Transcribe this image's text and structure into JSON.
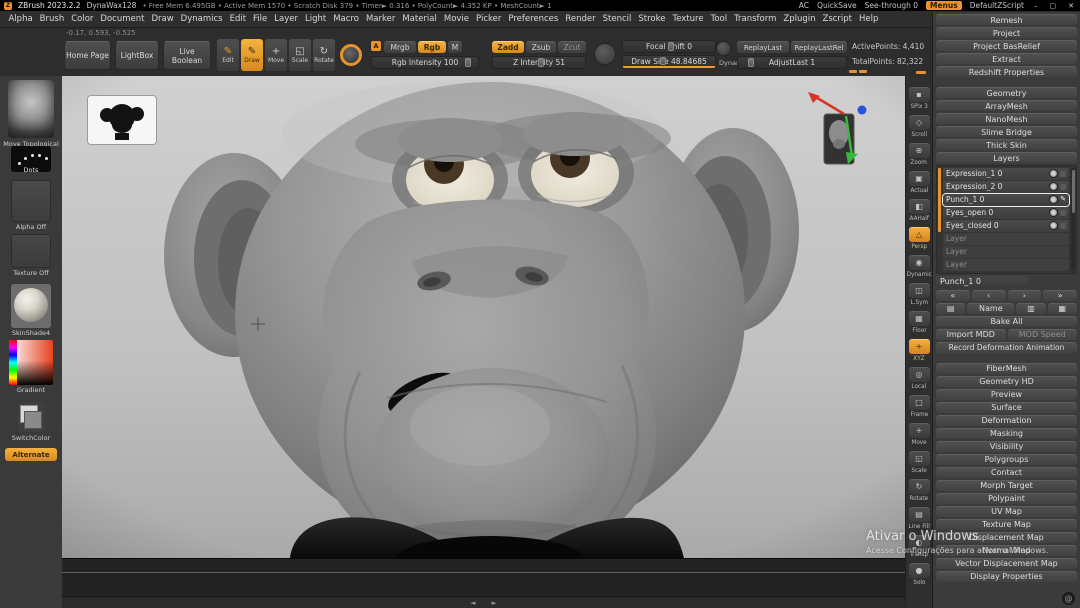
{
  "titlebar": {
    "logo_letter": "Z",
    "app_title": "ZBrush 2023.2.2",
    "doc_title": "DynaWax128",
    "stats": "• Free Mem 6.495GB • Active Mem 1570 • Scratch Disk 379 • Timer► 0.316 • PolyCount► 4.352 KP • MeshCount► 1",
    "right_items": [
      "AC",
      "QuickSave",
      "See-through 0"
    ],
    "menus_button": "Menus",
    "zscript_button": "DefaultZScript",
    "win_min": "–",
    "win_max": "▢",
    "win_close": "✕"
  },
  "menubar": {
    "items": [
      "Alpha",
      "Brush",
      "Color",
      "Document",
      "Draw",
      "Dynamics",
      "Edit",
      "File",
      "Layer",
      "Light",
      "Macro",
      "Marker",
      "Material",
      "Movie",
      "Picker",
      "Preferences",
      "Render",
      "Stencil",
      "Stroke",
      "Texture",
      "Tool",
      "Transform",
      "Zplugin",
      "Zscript",
      "Help"
    ]
  },
  "shelf": {
    "coords": "-0.17, 0.593, -0.525",
    "home_page": "Home Page",
    "lightbox": "LightBox",
    "live_boolean": "Live Boolean",
    "mode_edit": "Edit",
    "mode_draw": "Draw",
    "mode_move": "Move",
    "mode_scale": "Scale",
    "mode_rotate": "Rotate",
    "mode_icons": {
      "edit": "✎",
      "draw": "✎",
      "move": "+",
      "scale": "◱",
      "rotate": "↻"
    },
    "channel_a": "A",
    "mrgb": "Mrgb",
    "rgb": "Rgb",
    "m": "M",
    "zadd": "Zadd",
    "zsub": "Zsub",
    "zcut": "Zcut",
    "rgb_intensity": "Rgb Intensity 100",
    "z_intensity": "Z Intensity 51",
    "focal_shift": "Focal Shift 0",
    "draw_size": "Draw Size 48.84685",
    "dynamic_label": "Dynamic",
    "replay_last": "ReplayLast",
    "replay_last_rel": "ReplayLastRel",
    "adjust_last": "AdjustLast 1",
    "active_points": "ActivePoints: 4,410",
    "total_points": "TotalPoints: 82,322"
  },
  "left_tray": {
    "brush_label": "Move Topological",
    "stroke_label": "Dots",
    "alpha_label": "Alpha Off",
    "texture_label": "Texture Off",
    "material_label": "SkinShade4",
    "gradient_label": "Gradient",
    "switch_label": "SwitchColor",
    "alternate_label": "Alternate"
  },
  "right_strip": {
    "items": [
      {
        "label": "SPix 3",
        "glyph": "▪",
        "active": false
      },
      {
        "label": "Scroll",
        "glyph": "◇",
        "active": false
      },
      {
        "label": "Zoom",
        "glyph": "⊕",
        "active": false
      },
      {
        "label": "Actual",
        "glyph": "▣",
        "active": false
      },
      {
        "label": "AAHalf",
        "glyph": "◧",
        "active": false
      },
      {
        "label": "Persp",
        "glyph": "△",
        "active": true
      },
      {
        "label": "Dynamic",
        "glyph": "◉",
        "active": false
      },
      {
        "label": "L.Sym",
        "glyph": "◫",
        "active": false
      },
      {
        "label": "Floor",
        "glyph": "▦",
        "active": false
      },
      {
        "label": "XYZ",
        "glyph": "+",
        "active": true
      },
      {
        "label": "Local",
        "glyph": "◎",
        "active": false
      },
      {
        "label": "Frame",
        "glyph": "□",
        "active": false
      },
      {
        "label": "Move",
        "glyph": "+",
        "active": false
      },
      {
        "label": "Scale",
        "glyph": "◱",
        "active": false
      },
      {
        "label": "Rotate",
        "glyph": "↻",
        "active": false
      },
      {
        "label": "Line Fill",
        "glyph": "▤",
        "active": false
      },
      {
        "label": "Transp",
        "glyph": "◐",
        "active": false
      },
      {
        "label": "Solo",
        "glyph": "●",
        "active": false
      }
    ]
  },
  "tool_panel": {
    "top_buttons": [
      "Remesh",
      "Project",
      "Project BasRelief",
      "Extract",
      "Redshift Properties"
    ],
    "mid_sections": [
      "Geometry",
      "ArrayMesh",
      "NanoMesh",
      "Slime Bridge",
      "Thick Skin"
    ],
    "layers_title": "Layers",
    "layers": [
      {
        "name": "Expression_1 0"
      },
      {
        "name": "Expression_2 0"
      },
      {
        "name": "Punch_1 0"
      },
      {
        "name": "Eyes_open 0"
      },
      {
        "name": "Eyes_closed 0"
      },
      {
        "name": "Layer"
      },
      {
        "name": "Layer"
      },
      {
        "name": "Layer"
      }
    ],
    "rec_icon": "✎",
    "selected_layer": "Punch_1 0",
    "nav_buttons": [
      "«",
      "‹",
      "›",
      "»"
    ],
    "op_icons": [
      "▤",
      "▥",
      "▦"
    ],
    "name_button": "Name",
    "bake_all": "Bake All",
    "import_mdd": "Import MDD",
    "mod_speed": "MOD Speed",
    "record_button": "Record Deformation Animation",
    "bottom_sections": [
      "FiberMesh",
      "Geometry HD",
      "Preview",
      "Surface",
      "Deformation",
      "Masking",
      "Visibility",
      "Polygroups",
      "Contact",
      "Morph Target",
      "Polypaint",
      "UV Map",
      "Texture Map",
      "Displacement Map",
      "Normal Map",
      "Vector Displacement Map",
      "Display Properties"
    ]
  },
  "canvas": {
    "watermark_line1": "Ativar o Windows",
    "watermark_line2": "Acesse Configurações para ativar o Windows.",
    "scroll_left": "◄",
    "scroll_right": "►",
    "corner_badge": "@"
  },
  "colors": {
    "accent_orange": "#e8932c",
    "canvas_gray": "#c2c2c2",
    "panel_gray": "#3b3b3b"
  }
}
